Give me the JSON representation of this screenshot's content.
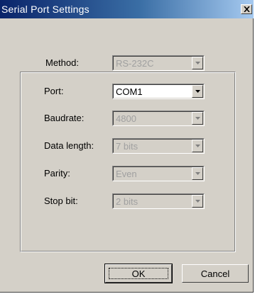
{
  "window": {
    "title": "Serial Port Settings"
  },
  "method": {
    "label": "Method:",
    "value": "RS-232C",
    "enabled": false
  },
  "fields": [
    {
      "label": "Port:",
      "value": "COM1",
      "enabled": true
    },
    {
      "label": "Baudrate:",
      "value": "4800",
      "enabled": false
    },
    {
      "label": "Data length:",
      "value": "7 bits",
      "enabled": false
    },
    {
      "label": "Parity:",
      "value": "Even",
      "enabled": false
    },
    {
      "label": "Stop bit:",
      "value": "2 bits",
      "enabled": false
    }
  ],
  "buttons": {
    "ok": "OK",
    "cancel": "Cancel"
  },
  "colors": {
    "titlebar_start": "#0a246a",
    "titlebar_end": "#a6caf0",
    "face": "#d4d0c8",
    "disabled_text": "#a0a0a0"
  }
}
